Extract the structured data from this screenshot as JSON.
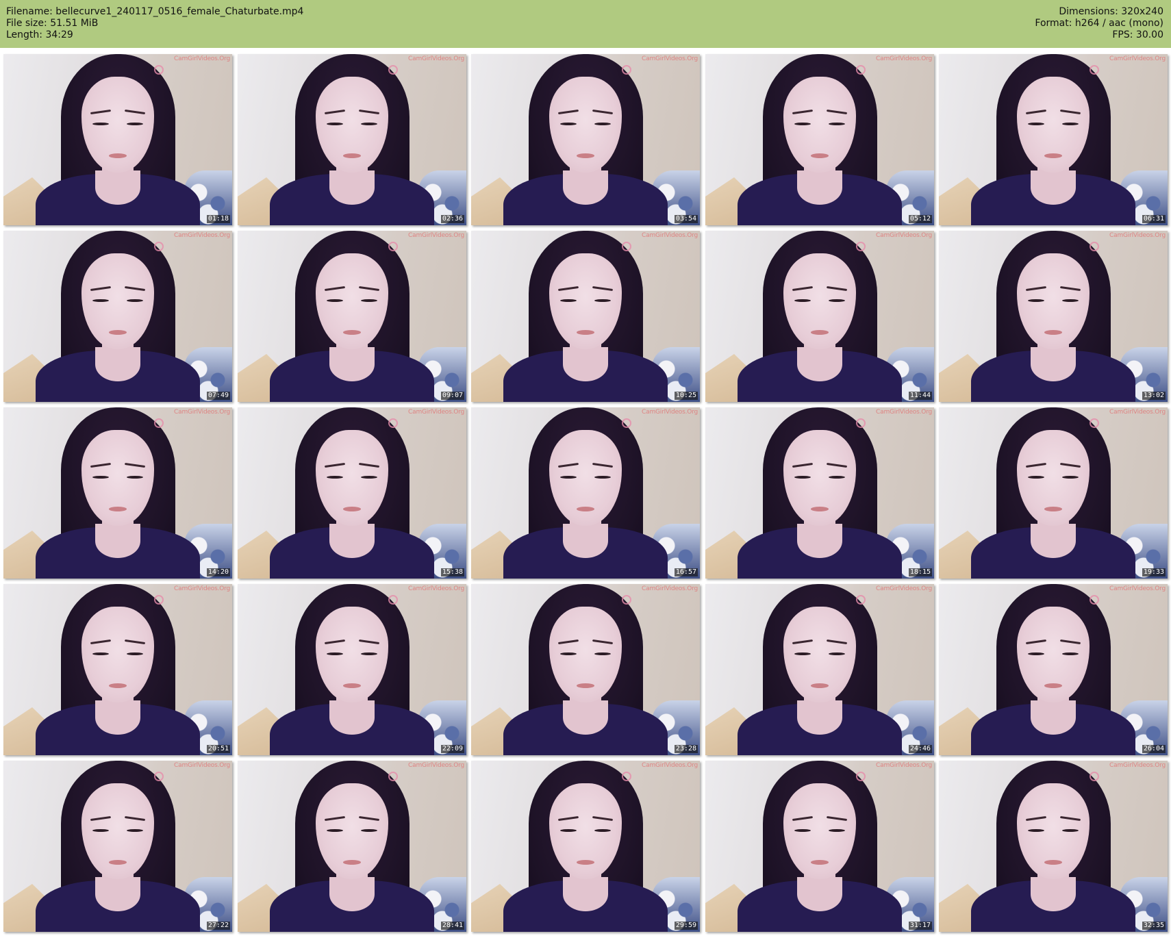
{
  "header": {
    "filename_line": "Filename: bellecurve1_240117_0516_female_Chaturbate.mp4",
    "filesize_line": "File size: 51.51 MiB",
    "length_line": "Length: 34:29",
    "dimensions_line": "Dimensions: 320x240",
    "format_line": "Format: h264 / aac (mono)",
    "fps_line": "FPS: 30.00",
    "background_color": "#b0ca80"
  },
  "thumbnails": [
    {
      "timestamp": "01:18"
    },
    {
      "timestamp": "02:36"
    },
    {
      "timestamp": "03:54"
    },
    {
      "timestamp": "05:12"
    },
    {
      "timestamp": "06:31"
    },
    {
      "timestamp": "07:49"
    },
    {
      "timestamp": "09:07"
    },
    {
      "timestamp": "10:25"
    },
    {
      "timestamp": "11:44"
    },
    {
      "timestamp": "13:02"
    },
    {
      "timestamp": "14:20"
    },
    {
      "timestamp": "15:38"
    },
    {
      "timestamp": "16:57"
    },
    {
      "timestamp": "18:15"
    },
    {
      "timestamp": "19:33"
    },
    {
      "timestamp": "20:51"
    },
    {
      "timestamp": "22:09"
    },
    {
      "timestamp": "23:28"
    },
    {
      "timestamp": "24:46"
    },
    {
      "timestamp": "26:04"
    },
    {
      "timestamp": "27:22"
    },
    {
      "timestamp": "28:41"
    },
    {
      "timestamp": "29:59"
    },
    {
      "timestamp": "31:17"
    },
    {
      "timestamp": "32:35"
    }
  ],
  "watermark": "CamGirlVideos.Org",
  "watermark_icon": "flower-icon"
}
